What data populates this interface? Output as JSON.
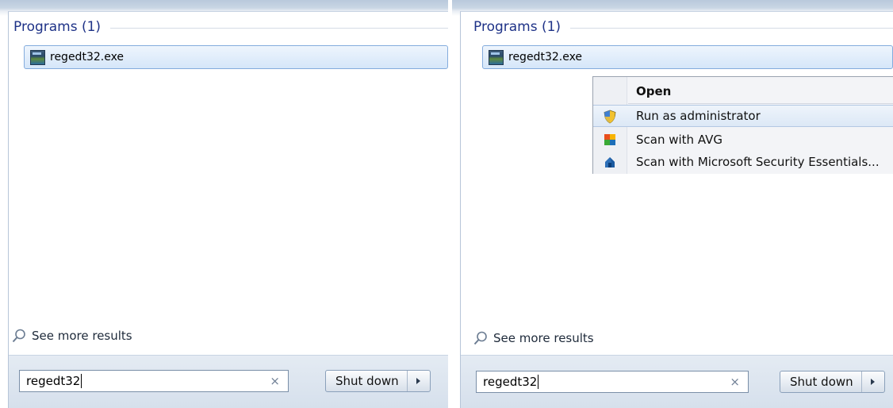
{
  "panels": [
    {
      "section_title": "Programs (1)",
      "program_label": "regedt32.exe",
      "see_more": "See more results",
      "search_value": "regedt32",
      "clear_glyph": "×",
      "shutdown_label": "Shut down"
    },
    {
      "section_title": "Programs (1)",
      "program_label": "regedt32.exe",
      "see_more": "See more results",
      "search_value": "regedt32",
      "clear_glyph": "×",
      "shutdown_label": "Shut down"
    }
  ],
  "context_menu": {
    "items": [
      {
        "label": "Open",
        "icon": "none"
      },
      {
        "label": "Run as administrator",
        "icon": "uac-shield-icon"
      },
      {
        "label": "Scan with AVG",
        "icon": "avg-icon"
      },
      {
        "label": "Scan with Microsoft Security Essentials...",
        "icon": "mse-icon"
      }
    ]
  },
  "colors": {
    "section_title": "#1e3287",
    "selection_border": "#84acdd",
    "menu_hover": "#dce8f6"
  }
}
